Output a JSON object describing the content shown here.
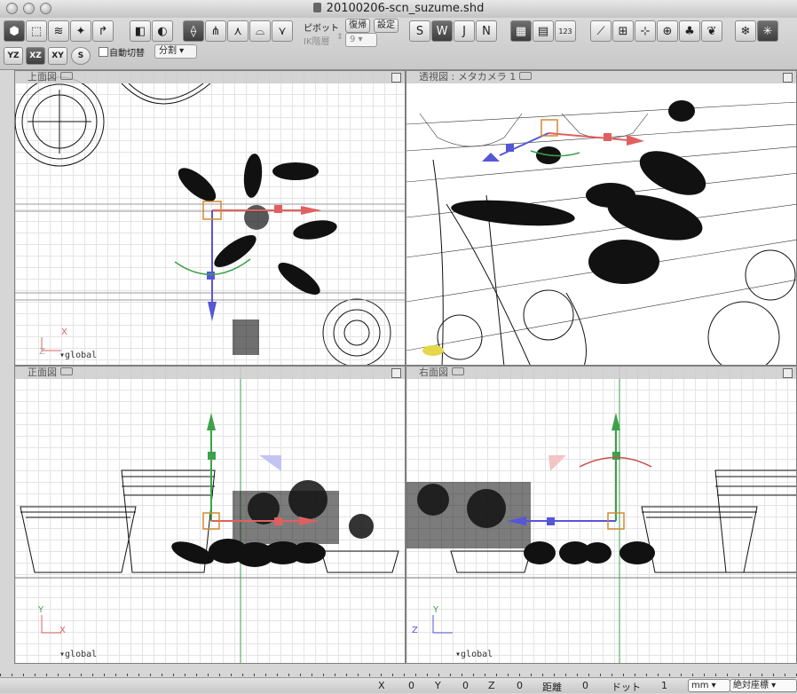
{
  "window": {
    "title": "20100206-scn_suzume.shd"
  },
  "toolbar": {
    "pivot_label": "ピボット",
    "reset_label": "復帰",
    "settings_label": "設定",
    "ik_label": "IK階層",
    "ik_value": "9",
    "auto_switch_label": "自動切替",
    "split_value": "分割",
    "plane_yz": "YZ",
    "plane_xz": "XZ",
    "plane_xy": "XY",
    "plane_s": "S",
    "numeric_label": "123"
  },
  "viewports": [
    {
      "title": "上面図",
      "axis_a": "X",
      "axis_b": "Z",
      "coord": "global"
    },
    {
      "title": "透視図 : メタカメラ 1"
    },
    {
      "title": "正面図",
      "axis_a": "Y",
      "axis_b": "X",
      "coord": "global"
    },
    {
      "title": "右面図",
      "axis_a": "Y",
      "axis_b": "Z",
      "coord": "global"
    }
  ],
  "status": {
    "x_label": "X",
    "x_value": "0",
    "y_label": "Y",
    "y_value": "0",
    "z_label": "Z",
    "z_value": "0",
    "dist_label": "距離",
    "dist_value": "0",
    "dot_label": "ドット",
    "dot_value": "1",
    "unit_value": "mm",
    "coord_mode_value": "絶対座標"
  },
  "colors": {
    "axis_x": "#e06060",
    "axis_y": "#3da14a",
    "axis_z": "#5656d8",
    "pivot": "#d08a30"
  }
}
